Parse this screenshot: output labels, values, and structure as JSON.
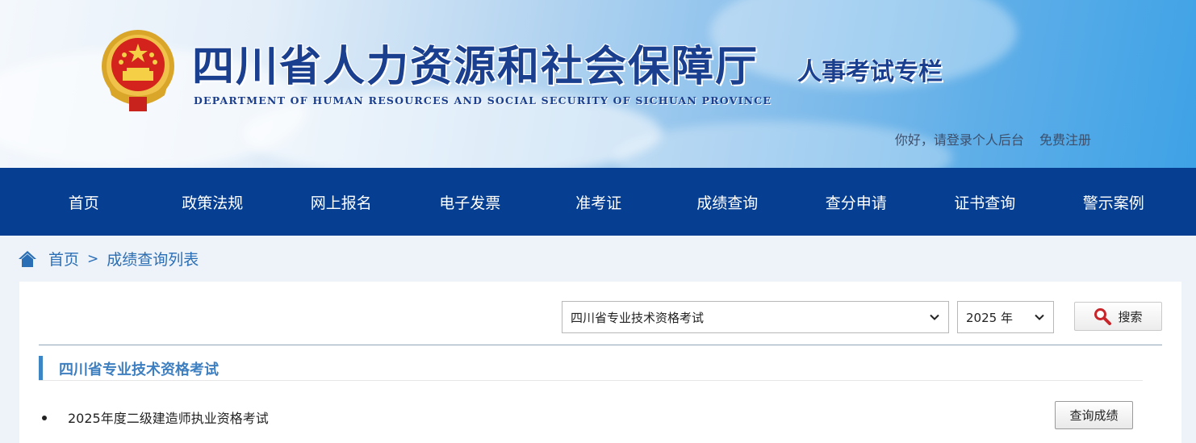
{
  "header": {
    "title_cn": "四川省人力资源和社会保障厅",
    "title_en": "DEPARTMENT OF HUMAN RESOURCES AND SOCIAL SECURITY OF SICHUAN PROVINCE",
    "subtitle": "人事考试专栏",
    "login_text": "你好，请登录个人后台",
    "register_text": "免费注册"
  },
  "nav": {
    "items": [
      "首页",
      "政策法规",
      "网上报名",
      "电子发票",
      "准考证",
      "成绩查询",
      "查分申请",
      "证书查询",
      "警示案例"
    ]
  },
  "breadcrumb": {
    "home": "首页",
    "separator": ">",
    "current": "成绩查询列表"
  },
  "search": {
    "exam_select_value": "四川省专业技术资格考试",
    "year_select_value": "2025 年",
    "button_label": "搜索"
  },
  "section": {
    "title": "四川省专业技术资格考试",
    "items": [
      {
        "name": "2025年度二级建造师执业资格考试",
        "action_label": "查询成绩"
      }
    ]
  },
  "colors": {
    "nav_bg": "#063f91",
    "title_blue": "#1b3f8f",
    "accent": "#3d86c6",
    "page_bg": "#eef2f9"
  },
  "icons": {
    "emblem": "national-emblem-icon",
    "home": "home-icon",
    "search": "magnifier-icon",
    "dropdown": "chevron-down-icon"
  }
}
